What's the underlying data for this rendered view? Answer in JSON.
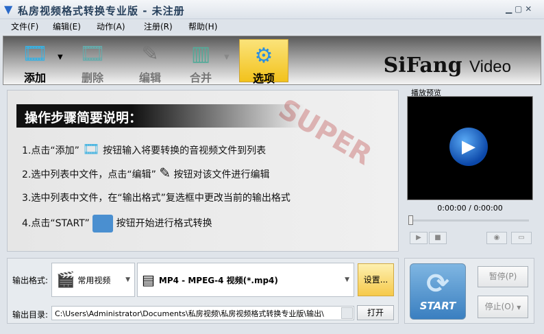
{
  "window": {
    "title": "私房视频格式转换专业版 - 未注册"
  },
  "menu": [
    "文件(F)",
    "编辑(E)",
    "动作(A)",
    "注册(R)",
    "帮助(H)"
  ],
  "toolbar": {
    "add": "添加",
    "delete": "删除",
    "edit": "编辑",
    "merge": "合并",
    "options": "选项"
  },
  "brand": {
    "name": "SiFang",
    "suffix": "Video"
  },
  "guide": {
    "title": "操作步骤简要说明：",
    "steps": [
      {
        "a": "1.点击“添加”",
        "b": "按钮输入将要转换的音视频文件到列表"
      },
      {
        "a": "2.选中列表中文件，点击“编辑”",
        "b": "按钮对该文件进行编辑"
      },
      {
        "a": "3.选中列表中文件，在“输出格式”复选框中更改当前的输出格式",
        "b": ""
      },
      {
        "a": "4.点击“START”",
        "b": "按钮开始进行格式转换"
      }
    ],
    "watermark": "SUPER"
  },
  "preview": {
    "label": "播放预览",
    "time": "0:00:00 / 0:00:00",
    "progress": 0
  },
  "output": {
    "format_label": "输出格式:",
    "category": "常用视频",
    "format": "MP4 - MPEG-4 视频(*.mp4)",
    "settings": "设置...",
    "dir_label": "输出目录:",
    "dir": "C:\\Users\\Administrator\\Documents\\私房视频\\私房视频格式转换专业版\\输出\\",
    "open": "打开"
  },
  "controls": {
    "start": "START",
    "pause": "暂停(P)",
    "stop": "停止(O)"
  }
}
